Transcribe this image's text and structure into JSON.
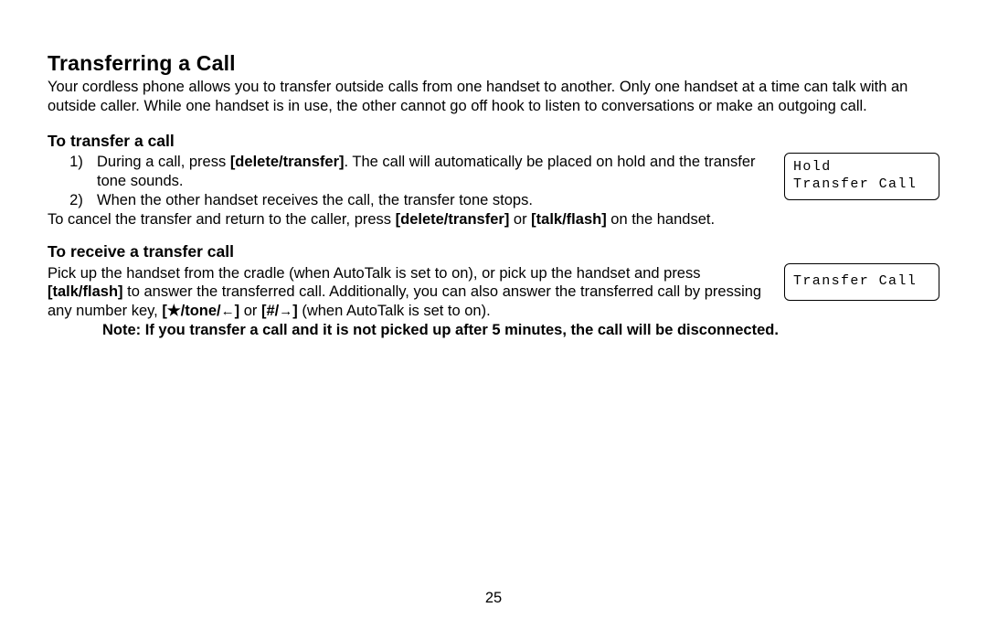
{
  "title": "Transferring a Call",
  "intro": "Your cordless phone allows you to transfer outside calls from one handset to another. Only one handset at a time can talk with an outside caller. While one handset is in use, the other cannot go off hook to listen to conversations or make an outgoing call.",
  "section1": {
    "heading": "To transfer a call",
    "item1_pre": "During a call, press ",
    "item1_bold": "[delete/transfer]",
    "item1_post": ". The call will automatically be placed on hold and the transfer tone sounds.",
    "item2": "When the other handset receives the call, the transfer tone stops.",
    "cancel_pre": "To cancel the transfer and return to the caller, press ",
    "cancel_b1": "[delete/transfer]",
    "cancel_mid": " or ",
    "cancel_b2": "[talk/flash]",
    "cancel_post": " on the handset.",
    "lcd_line1": " Hold",
    "lcd_line2": "Transfer Call"
  },
  "section2": {
    "heading": "To receive a transfer call",
    "para_pre": "Pick up the handset from the cradle (when AutoTalk is set to on), or pick up the handset and press ",
    "para_b1": "[talk/flash]",
    "para_mid1": " to answer the transferred call. Additionally, you can also answer the transferred call by pressing any number key, ",
    "key1_open": "[",
    "key1_star": "★",
    "key1_text": "/tone/",
    "key1_close": "]",
    "para_mid2": " or ",
    "key2_open": "[#/",
    "key2_close": "]",
    "para_post": " (when AutoTalk is set to on).",
    "lcd_line1": "Transfer Call"
  },
  "note": "Note: If you transfer a call and it is not picked up after 5 minutes, the call will be disconnected.",
  "page_number": "25"
}
